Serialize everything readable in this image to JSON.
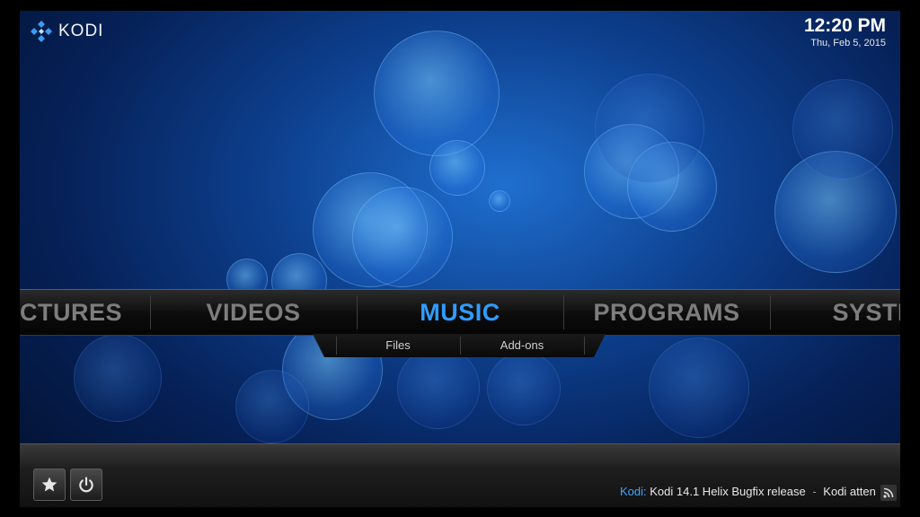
{
  "app": {
    "name": "KODI"
  },
  "clock": {
    "time": "12:20 PM",
    "date": "Thu, Feb 5, 2015"
  },
  "main_menu": {
    "items": [
      "CTURES",
      "VIDEOS",
      "MUSIC",
      "PROGRAMS",
      "SYSTE"
    ],
    "active": "MUSIC"
  },
  "submenu": {
    "items": [
      "Files",
      "Add-ons"
    ]
  },
  "bottom": {
    "buttons": [
      "favourites-star-icon",
      "power-icon"
    ],
    "ticker": {
      "source": "Kodi:",
      "headline": "Kodi 14.1 Helix Bugfix release",
      "separator": "-",
      "next": "Kodi atten"
    }
  },
  "colors": {
    "accent": "#2f9cff",
    "menu_inactive": "#7d7d7d"
  }
}
